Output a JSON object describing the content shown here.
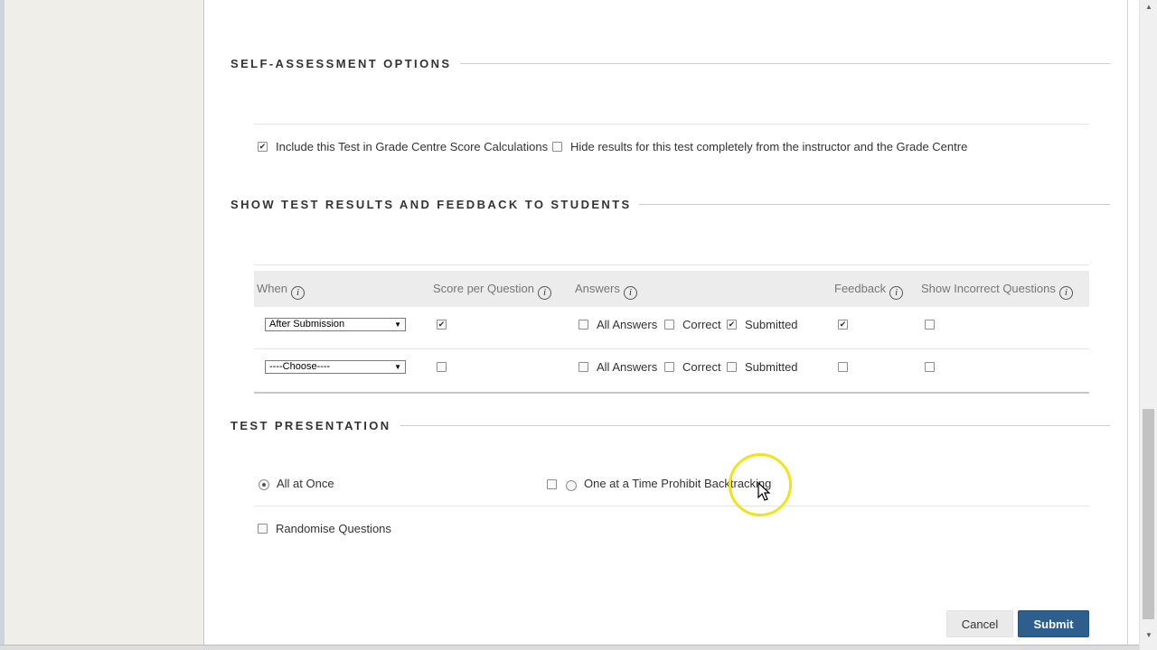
{
  "self_assessment": {
    "title": "SELF-ASSESSMENT OPTIONS",
    "include_label": "Include this Test in Grade Centre Score Calculations",
    "include_checked": true,
    "hide_label": "Hide results for this test completely from the instructor and the Grade Centre",
    "hide_checked": false
  },
  "feedback": {
    "title": "SHOW TEST RESULTS AND FEEDBACK TO STUDENTS",
    "columns": {
      "when": "When",
      "score": "Score per Question",
      "answers": "Answers",
      "feedback": "Feedback",
      "incorrect": "Show Incorrect Questions"
    },
    "info_glyph": "i",
    "rows": [
      {
        "when": "After Submission",
        "score": true,
        "all_answers_label": "All Answers",
        "all_answers": false,
        "correct_label": "Correct",
        "correct": false,
        "submitted_label": "Submitted",
        "submitted": true,
        "feedback": true,
        "incorrect": false
      },
      {
        "when": "----Choose----",
        "score": false,
        "all_answers_label": "All Answers",
        "all_answers": false,
        "correct_label": "Correct",
        "correct": false,
        "submitted_label": "Submitted",
        "submitted": false,
        "feedback": false,
        "incorrect": false
      }
    ]
  },
  "presentation": {
    "title": "TEST PRESENTATION",
    "all_at_once_label": "All at Once",
    "all_at_once_selected": true,
    "one_at_a_time_label": "One at a Time",
    "one_at_a_time_selected": false,
    "prohibit_label": "Prohibit Backtracking",
    "prohibit_checked": false,
    "randomise_label": "Randomise Questions",
    "randomise_checked": false
  },
  "buttons": {
    "cancel": "Cancel",
    "submit": "Submit"
  },
  "colors": {
    "submit_bg": "#2e5e8e",
    "highlight": "#f2e21a"
  },
  "icons": {
    "select_caret": "▼",
    "scroll_up": "▲",
    "scroll_down": "▼"
  }
}
